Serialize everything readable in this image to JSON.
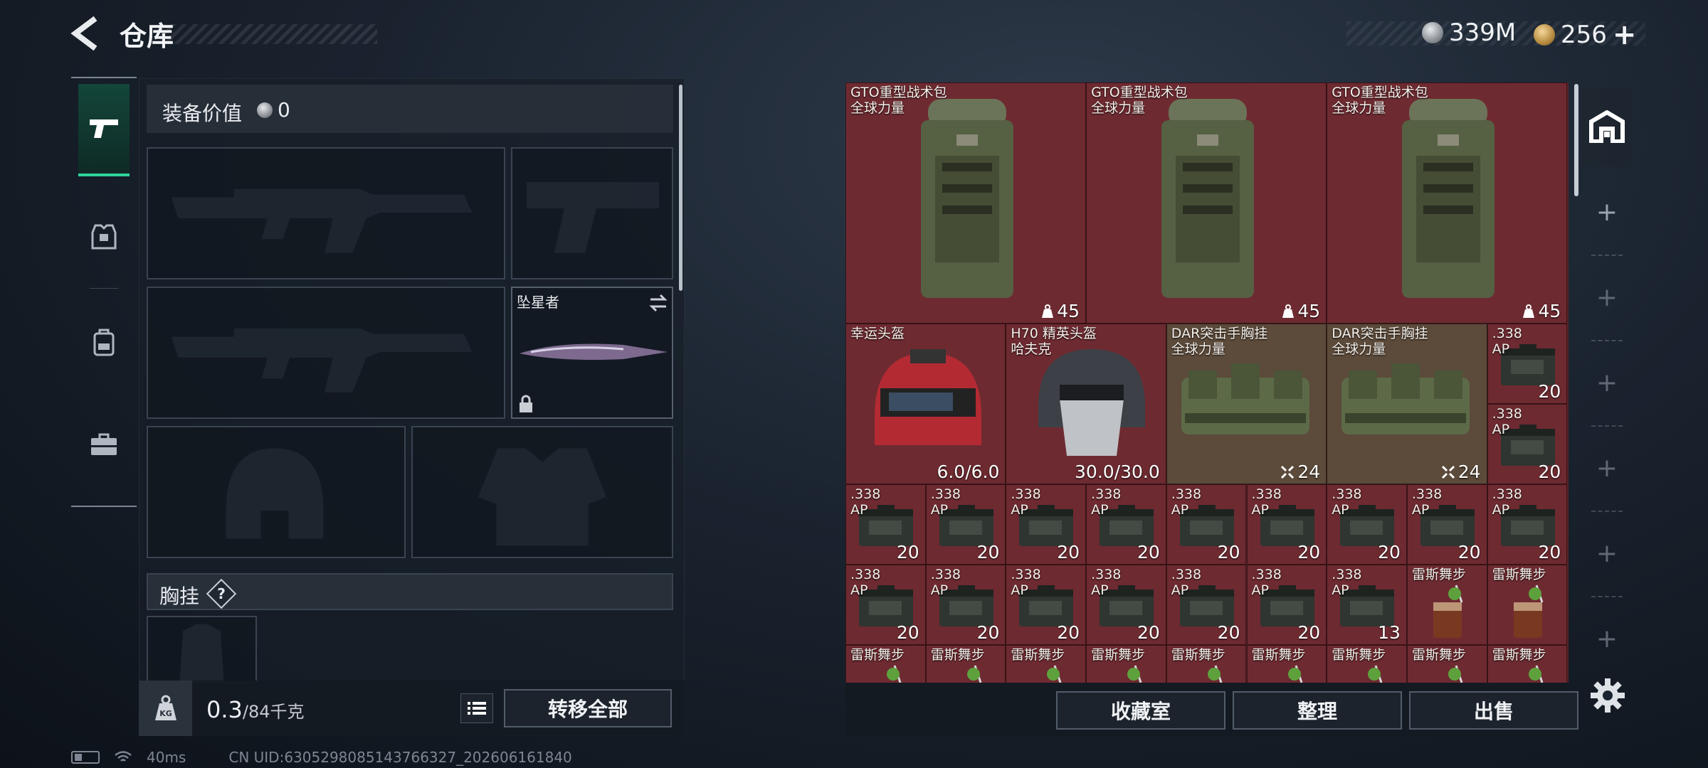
{
  "header": {
    "title": "仓库"
  },
  "currency": {
    "silver": "339M",
    "gold": "256",
    "add_symbol": "+"
  },
  "equipment": {
    "value_label": "装备价值",
    "value": "0",
    "melee_slot_label": "坠星者",
    "vest_label": "胸挂",
    "vest_help": "?"
  },
  "weight": {
    "current": "0.3",
    "capacity": "/84千克"
  },
  "buttons": {
    "transfer_all": "转移全部",
    "collection": "收藏室",
    "organize": "整理",
    "sell": "出售"
  },
  "side_tabs": {
    "add_symbol": "+"
  },
  "status": {
    "ping": "40ms",
    "uid": "CN UID:6305298085143766327_202606161840"
  },
  "colors": {
    "active_tab": "#2fd59b",
    "cell_bg": "#6e2a31",
    "cell_gold_bg": "#5c4a3a"
  },
  "items": {
    "backpacks": [
      {
        "name": "GTO重型战术包\n全球力量",
        "qty": "45"
      },
      {
        "name": "GTO重型战术包\n全球力量",
        "qty": "45"
      },
      {
        "name": "GTO重型战术包\n全球力量",
        "qty": "45"
      }
    ],
    "helmets": [
      {
        "name": "幸运头盔",
        "durability": "6.0/6.0"
      },
      {
        "name": "H70 精英头盔\n哈夫克",
        "durability": "30.0/30.0"
      }
    ],
    "rigs": [
      {
        "name": "DAR突击手胸挂\n全球力量",
        "qty": "24"
      },
      {
        "name": "DAR突击手胸挂\n全球力量",
        "qty": "24"
      }
    ],
    "ammo_side": [
      {
        "name": ".338\nAP",
        "qty": "20"
      },
      {
        "name": ".338\nAP",
        "qty": "20"
      }
    ],
    "ammo_row3": [
      {
        "name": ".338\nAP",
        "qty": "20"
      },
      {
        "name": ".338\nAP",
        "qty": "20"
      },
      {
        "name": ".338\nAP",
        "qty": "20"
      },
      {
        "name": ".338\nAP",
        "qty": "20"
      },
      {
        "name": ".338\nAP",
        "qty": "20"
      },
      {
        "name": ".338\nAP",
        "qty": "20"
      },
      {
        "name": ".338\nAP",
        "qty": "20"
      },
      {
        "name": ".338\nAP",
        "qty": "20"
      },
      {
        "name": ".338\nAP",
        "qty": "20"
      }
    ],
    "row4": [
      {
        "name": ".338\nAP",
        "qty": "20",
        "kind": "ammo"
      },
      {
        "name": ".338\nAP",
        "qty": "20",
        "kind": "ammo"
      },
      {
        "name": ".338\nAP",
        "qty": "20",
        "kind": "ammo"
      },
      {
        "name": ".338\nAP",
        "qty": "20",
        "kind": "ammo"
      },
      {
        "name": ".338\nAP",
        "qty": "20",
        "kind": "ammo"
      },
      {
        "name": ".338\nAP",
        "qty": "20",
        "kind": "ammo"
      },
      {
        "name": ".338\nAP",
        "qty": "13",
        "kind": "ammo"
      },
      {
        "name": "雷斯舞步",
        "qty": "",
        "kind": "drink"
      },
      {
        "name": "雷斯舞步",
        "qty": "",
        "kind": "drink"
      }
    ],
    "row5": [
      {
        "name": "雷斯舞步"
      },
      {
        "name": "雷斯舞步"
      },
      {
        "name": "雷斯舞步"
      },
      {
        "name": "雷斯舞步"
      },
      {
        "name": "雷斯舞步"
      },
      {
        "name": "雷斯舞步"
      },
      {
        "name": "雷斯舞步"
      },
      {
        "name": "雷斯舞步"
      },
      {
        "name": "雷斯舞步"
      }
    ]
  }
}
